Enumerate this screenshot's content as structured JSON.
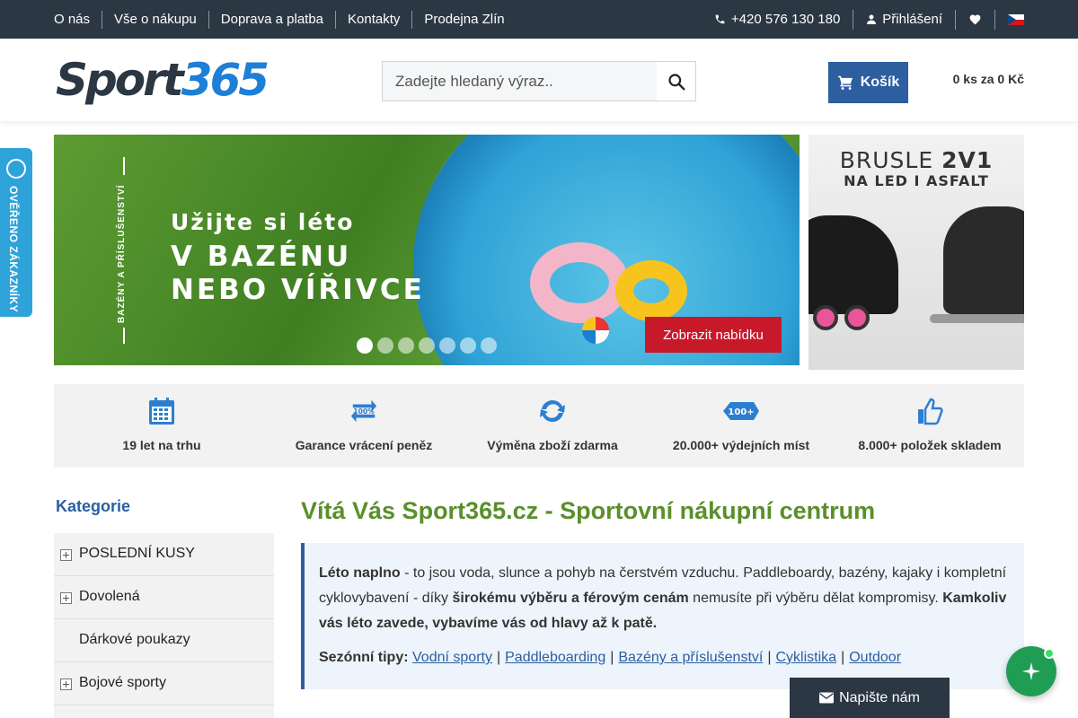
{
  "topbar": {
    "nav": [
      "O nás",
      "Vše o nákupu",
      "Doprava a platba",
      "Kontakty",
      "Prodejna Zlín"
    ],
    "phone": "+420 576 130 180",
    "login": "Přihlášení"
  },
  "header": {
    "logo_part1": "Sport",
    "logo_part2": "365",
    "search_placeholder": "Zadejte hledaný výraz..",
    "cart_label": "Košík",
    "cart_summary": "0 ks za 0 Kč"
  },
  "verified_badge": "OVĚŘENO ZÁKAZNÍKY",
  "banner": {
    "vertical_text": "BAZÉNY A PŘÍSLUŠENSTVÍ",
    "headline_small": "Užijte si léto",
    "headline_big_1": "V BAZÉNU",
    "headline_big_2": "NEBO VÍŘIVCE",
    "button": "Zobrazit nabídku",
    "slide_count": 7,
    "active_slide": 0
  },
  "side_banner": {
    "line1_a": "BRUSLE ",
    "line1_b": "2V1",
    "line2": "NA LED I ASFALT"
  },
  "benefits": [
    {
      "icon": "calendar-icon",
      "label": "19 let na trhu"
    },
    {
      "icon": "money-back-icon",
      "label": "Garance vrácení peněz",
      "icon_text": "100%"
    },
    {
      "icon": "exchange-icon",
      "label": "Výměna zboží zdarma"
    },
    {
      "icon": "pickup-points-icon",
      "label": "20.000+ výdejních míst",
      "icon_text": "100+"
    },
    {
      "icon": "thumbs-up-icon",
      "label": "8.000+ položek skladem"
    }
  ],
  "categories": {
    "title": "Kategorie",
    "items": [
      {
        "label": "POSLEDNÍ KUSY",
        "expandable": true
      },
      {
        "label": "Dovolená",
        "expandable": true
      },
      {
        "label": "Dárkové poukazy",
        "expandable": false
      },
      {
        "label": "Bojové sporty",
        "expandable": true
      }
    ]
  },
  "main": {
    "title": "Vítá Vás Sport365.cz - Sportovní nákupní centrum",
    "intro_b1": "Léto naplno",
    "intro_t1": " - to jsou voda, slunce a pohyb na čerstvém vzduchu. Paddleboardy, bazény, kajaky i kompletní cyklovybavení - díky ",
    "intro_b2": "širokému výběru a férovým cenám",
    "intro_t2": " nemusíte při výběru dělat kompromisy. ",
    "intro_b3": "Kamkoliv vás léto zavede, vybavíme vás od hlavy až k patě.",
    "tips_label": "Sezónní tipy:",
    "tips": [
      "Vodní sporty",
      "Paddleboarding",
      "Bazény a příslušenství",
      "Cyklistika",
      "Outdoor"
    ]
  },
  "write_us": "Napište nám",
  "colors": {
    "topbar": "#2c3744",
    "brand_blue": "#2c5ea0",
    "accent_green": "#5a8f2a",
    "offer_red": "#c8192b",
    "chat_green": "#1f9d55"
  }
}
